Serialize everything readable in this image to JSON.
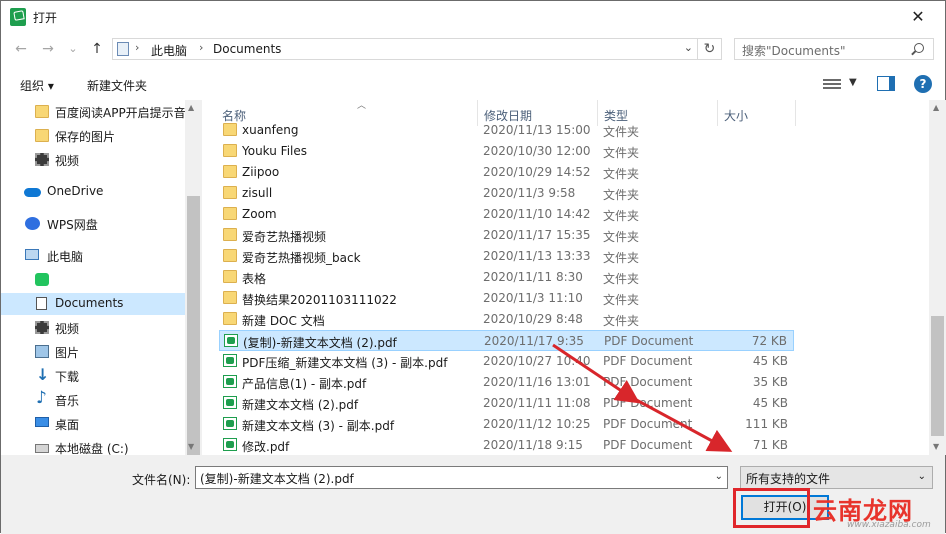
{
  "window": {
    "title": "打开",
    "close_glyph": "✕"
  },
  "nav": {
    "back_glyph": "←",
    "forward_glyph": "→",
    "recent_glyph": "⌄",
    "up_glyph": "↑",
    "breadcrumb": [
      "此电脑",
      "Documents"
    ],
    "refresh_glyph": "↻",
    "search_placeholder": "搜索\"Documents\""
  },
  "toolbar": {
    "organize": "组织 ▾",
    "new_folder": "新建文件夹"
  },
  "sidebar": {
    "items": [
      {
        "label": "百度阅读APP开启提示音",
        "icon": "folder-icon"
      },
      {
        "label": "保存的图片",
        "icon": "folder-icon"
      },
      {
        "label": "视频",
        "icon": "film-icon"
      },
      {
        "label": "OneDrive",
        "icon": "cloud-icon"
      },
      {
        "label": "WPS网盘",
        "icon": "wps-cloud-icon"
      },
      {
        "label": "此电脑",
        "icon": "computer-icon"
      },
      {
        "label": "",
        "icon": "app-icon"
      },
      {
        "label": "Documents",
        "icon": "document-icon",
        "selected": true
      },
      {
        "label": "视频",
        "icon": "film-icon"
      },
      {
        "label": "图片",
        "icon": "picture-icon"
      },
      {
        "label": "下载",
        "icon": "download-icon"
      },
      {
        "label": "音乐",
        "icon": "music-icon"
      },
      {
        "label": "桌面",
        "icon": "desktop-icon"
      },
      {
        "label": "本地磁盘 (C:)",
        "icon": "disk-icon"
      }
    ]
  },
  "columns": {
    "name": "名称",
    "date": "修改日期",
    "type": "类型",
    "size": "大小"
  },
  "files": [
    {
      "name": "xuanfeng",
      "date": "2020/11/13 15:00",
      "type": "文件夹",
      "size": "",
      "kind": "folder"
    },
    {
      "name": "Youku Files",
      "date": "2020/10/30 12:00",
      "type": "文件夹",
      "size": "",
      "kind": "folder"
    },
    {
      "name": "Ziipoo",
      "date": "2020/10/29 14:52",
      "type": "文件夹",
      "size": "",
      "kind": "folder"
    },
    {
      "name": "zisull",
      "date": "2020/11/3 9:58",
      "type": "文件夹",
      "size": "",
      "kind": "folder"
    },
    {
      "name": "Zoom",
      "date": "2020/11/10 14:42",
      "type": "文件夹",
      "size": "",
      "kind": "folder"
    },
    {
      "name": "爱奇艺热播视频",
      "date": "2020/11/17 15:35",
      "type": "文件夹",
      "size": "",
      "kind": "folder"
    },
    {
      "name": "爱奇艺热播视频_back",
      "date": "2020/11/13 13:33",
      "type": "文件夹",
      "size": "",
      "kind": "folder"
    },
    {
      "name": "表格",
      "date": "2020/11/11 8:30",
      "type": "文件夹",
      "size": "",
      "kind": "folder"
    },
    {
      "name": "替换结果20201103111022",
      "date": "2020/11/3 11:10",
      "type": "文件夹",
      "size": "",
      "kind": "folder"
    },
    {
      "name": "新建 DOC 文档",
      "date": "2020/10/29 8:48",
      "type": "文件夹",
      "size": "",
      "kind": "folder"
    },
    {
      "name": "(复制)-新建文本文档 (2).pdf",
      "date": "2020/11/17 9:35",
      "type": "PDF Document",
      "size": "72 KB",
      "kind": "pdf",
      "selected": true
    },
    {
      "name": "PDF压缩_新建文本文档 (3) - 副本.pdf",
      "date": "2020/10/27 10:40",
      "type": "PDF Document",
      "size": "45 KB",
      "kind": "pdf"
    },
    {
      "name": "产品信息(1) - 副本.pdf",
      "date": "2020/11/16 13:01",
      "type": "PDF Document",
      "size": "35 KB",
      "kind": "pdf"
    },
    {
      "name": "新建文本文档 (2).pdf",
      "date": "2020/11/11 11:08",
      "type": "PDF Document",
      "size": "45 KB",
      "kind": "pdf"
    },
    {
      "name": "新建文本文档 (3) - 副本.pdf",
      "date": "2020/11/12 10:25",
      "type": "PDF Document",
      "size": "111 KB",
      "kind": "pdf"
    },
    {
      "name": "修改.pdf",
      "date": "2020/11/18 9:15",
      "type": "PDF Document",
      "size": "71 KB",
      "kind": "pdf"
    }
  ],
  "bottom": {
    "filename_label": "文件名(N):",
    "filename_value": "(复制)-新建文本文档 (2).pdf",
    "filetype_value": "所有支持的文件",
    "open_label": "打开(O)"
  },
  "watermark": {
    "text": "云南龙网",
    "sub": "www.xiazaiba.com"
  },
  "colors": {
    "selection": "#cce8ff",
    "accent": "#0078d7",
    "highlight": "#e0262b",
    "folder": "#f8d775"
  }
}
